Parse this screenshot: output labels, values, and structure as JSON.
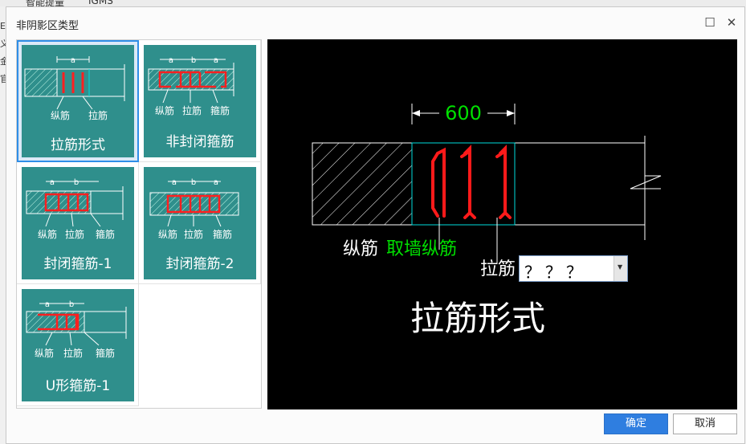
{
  "background": {
    "menu": [
      "智能提量",
      "IGMS"
    ],
    "edge_chars": [
      "E",
      "义",
      "金",
      "官"
    ]
  },
  "dialog": {
    "title": "非阴影区类型",
    "maximize_glyph": "☐",
    "close_glyph": "✕"
  },
  "types": [
    {
      "title": "拉筋形式",
      "dims": [
        "a"
      ],
      "labels": [
        "纵筋",
        "拉筋"
      ],
      "selected": true
    },
    {
      "title": "非封闭箍筋",
      "dims": [
        "a",
        "b",
        "a"
      ],
      "labels": [
        "纵筋",
        "拉筋",
        "箍筋"
      ],
      "selected": false
    },
    {
      "title": "封闭箍筋-1",
      "dims": [
        "a",
        "b"
      ],
      "labels": [
        "纵筋",
        "拉筋",
        "箍筋"
      ],
      "selected": false
    },
    {
      "title": "封闭箍筋-2",
      "dims": [
        "a",
        "b",
        "a"
      ],
      "labels": [
        "纵筋",
        "拉筋",
        "箍筋"
      ],
      "selected": false
    },
    {
      "title": "U形箍筋-1",
      "dims": [
        "a",
        "b"
      ],
      "labels": [
        "纵筋",
        "拉筋",
        "箍筋"
      ],
      "selected": false
    }
  ],
  "preview": {
    "dimension": "600",
    "label_longitudinal": "纵筋",
    "label_longitudinal_value": "取墙纵筋",
    "label_tie": "拉筋",
    "tie_value": "？？？",
    "caption": "拉筋形式",
    "colors": {
      "dimension": "#00e000",
      "rebar": "#ff1a1a",
      "cyan": "#00d0d0",
      "white": "#ffffff"
    }
  },
  "buttons": {
    "ok": "确定",
    "cancel": "取消"
  }
}
